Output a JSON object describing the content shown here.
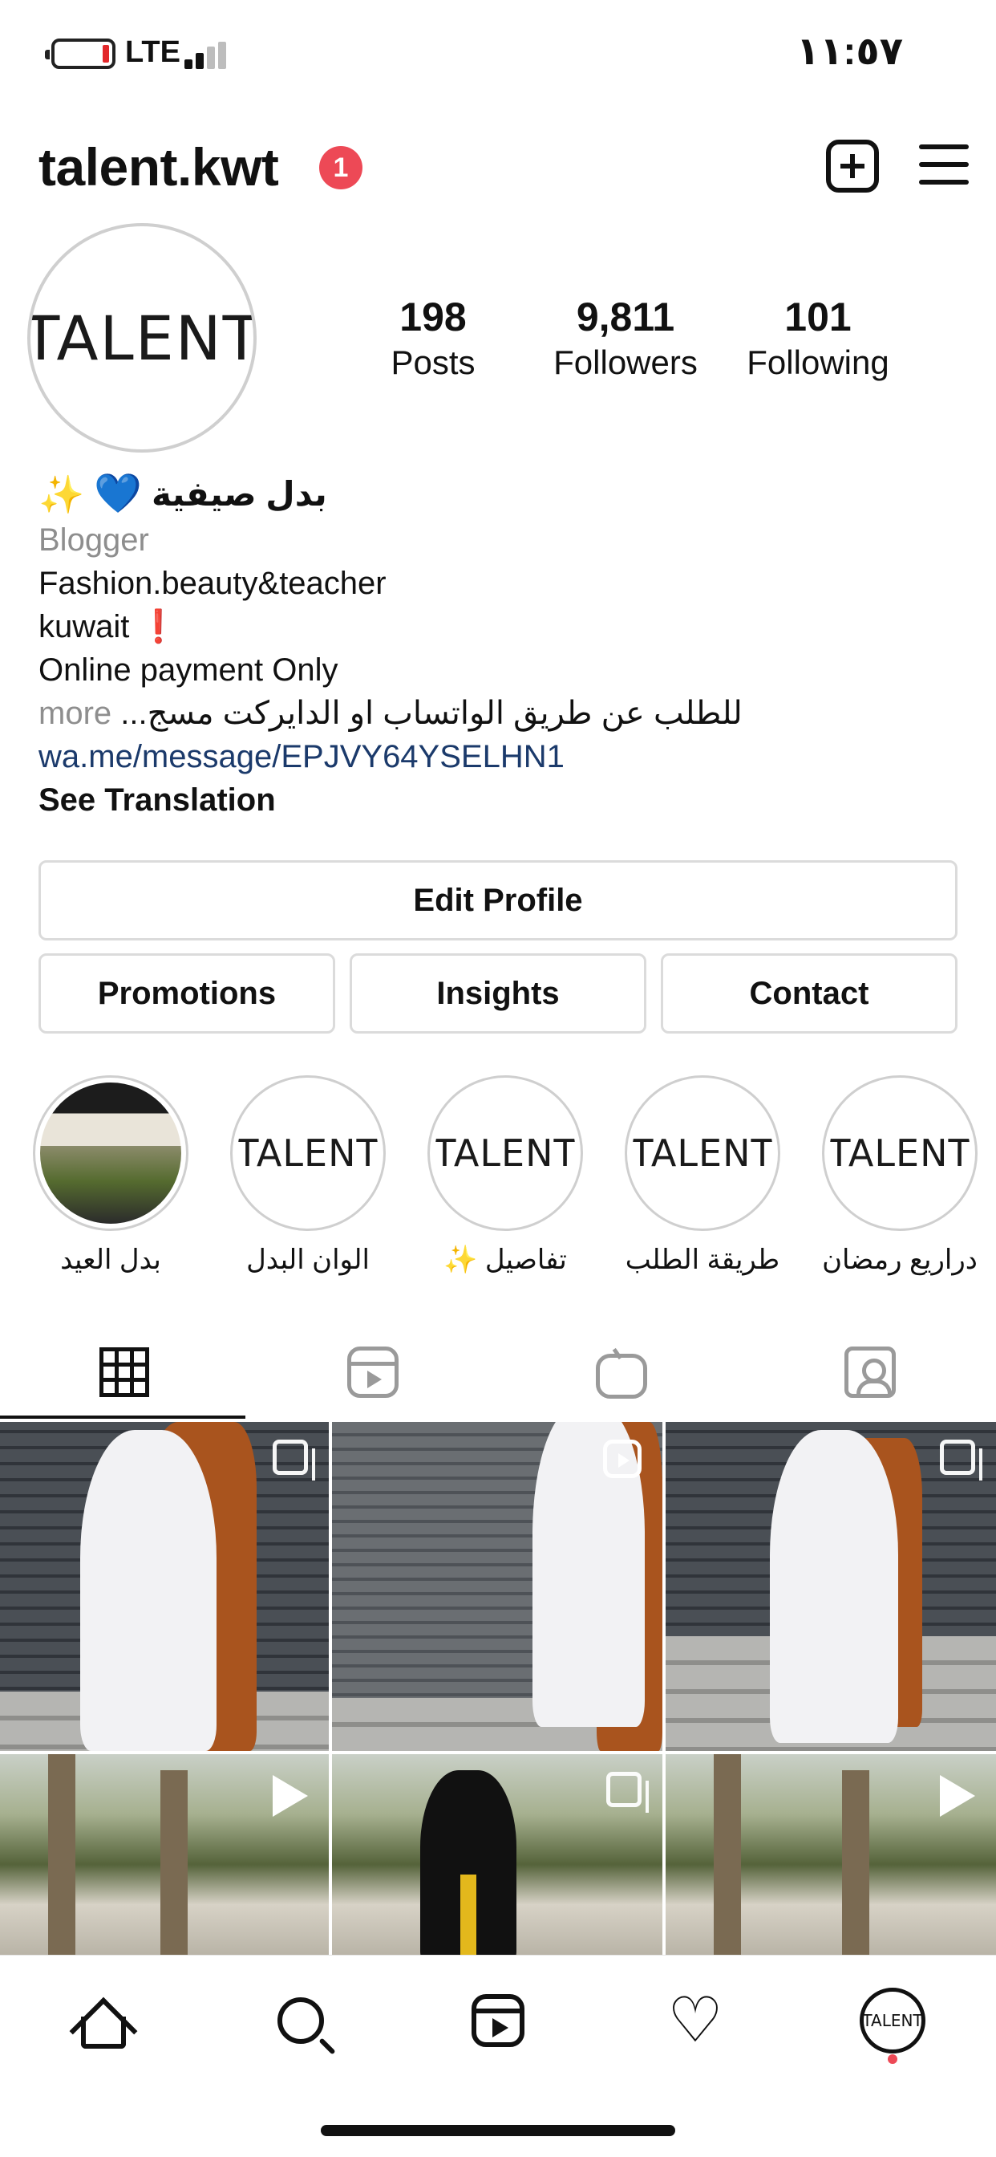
{
  "status_bar": {
    "network": "LTE",
    "time": "١١:٥٧"
  },
  "header": {
    "username": "talent.kwt",
    "notification_count": "1"
  },
  "profile": {
    "avatar_text": "TALENT",
    "stats": {
      "posts_count": "198",
      "posts_label": "Posts",
      "followers_count": "9,811",
      "followers_label": "Followers",
      "following_count": "101",
      "following_label": "Following"
    }
  },
  "bio": {
    "name": "بدل صيفية",
    "name_emoji_heart": "💙",
    "name_emoji_sparkles": "✨",
    "category": "Blogger",
    "line1": "Fashion.beauty&teacher",
    "line2": "kuwait",
    "line2_emoji": "❗",
    "line3": "Online payment Only",
    "line4": "للطلب عن طريق الواتساب او الدايركت مسج...",
    "more_label": "more",
    "link": "wa.me/message/EPJVY64YSELHN1",
    "see_translation": "See Translation"
  },
  "buttons": {
    "edit_profile": "Edit Profile",
    "promotions": "Promotions",
    "insights": "Insights",
    "contact": "Contact"
  },
  "highlights": [
    {
      "label": "بدل العيد",
      "type": "photo"
    },
    {
      "label": "الوان البدل",
      "type": "logo",
      "logo_text": "TALENT"
    },
    {
      "label": "تفاصيل ✨",
      "type": "logo",
      "logo_text": "TALENT"
    },
    {
      "label": "طريقة الطلب",
      "type": "logo",
      "logo_text": "TALENT"
    },
    {
      "label": "دراريع رمضان",
      "type": "logo",
      "logo_text": "TALENT"
    }
  ],
  "tabs": [
    {
      "icon": "grid-icon",
      "active": true
    },
    {
      "icon": "reels-icon",
      "active": false
    },
    {
      "icon": "igtv-icon",
      "active": false
    },
    {
      "icon": "tagged-icon",
      "active": false
    }
  ],
  "posts": [
    {
      "scene": "wall-dress",
      "badge": "carousel-icon"
    },
    {
      "scene": "wall-dress-legs",
      "badge": "reel-icon"
    },
    {
      "scene": "stairs-dress",
      "badge": "carousel-icon"
    },
    {
      "scene": "palms",
      "badge": "video-play-icon"
    },
    {
      "scene": "black-abaya",
      "badge": "carousel-icon"
    },
    {
      "scene": "palms",
      "badge": "video-play-icon"
    }
  ],
  "bottom_nav": {
    "profile_text": "TALENT"
  },
  "colors": {
    "badge_red": "#ed4956",
    "link_blue": "#1b3a6b",
    "muted_gray": "#8e8e8e",
    "border_gray": "#dbdbdb"
  }
}
